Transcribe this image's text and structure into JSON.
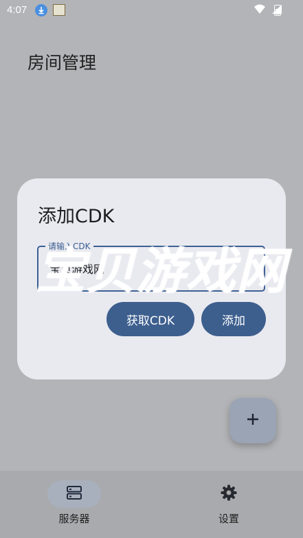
{
  "status_bar": {
    "time": "4:07"
  },
  "app": {
    "title": "房间管理"
  },
  "dialog": {
    "title": "添加CDK",
    "cdk_field": {
      "label": "请输入CDK",
      "value": "宝贝游戏网"
    },
    "get_cdk_label": "获取CDK",
    "add_label": "添加"
  },
  "fab": {
    "icon": "plus-icon"
  },
  "bottom_nav": {
    "items": [
      {
        "label": "服务器",
        "icon": "server-icon",
        "selected": true
      },
      {
        "label": "设置",
        "icon": "gear-icon",
        "selected": false
      }
    ]
  },
  "watermark": {
    "text": "宝贝游戏网"
  },
  "colors": {
    "primary": "#3d5f8e",
    "dialog_bg": "#e9eaf0",
    "scrim_bg": "#b3b4b7",
    "nav_bg": "#a9aaad"
  }
}
